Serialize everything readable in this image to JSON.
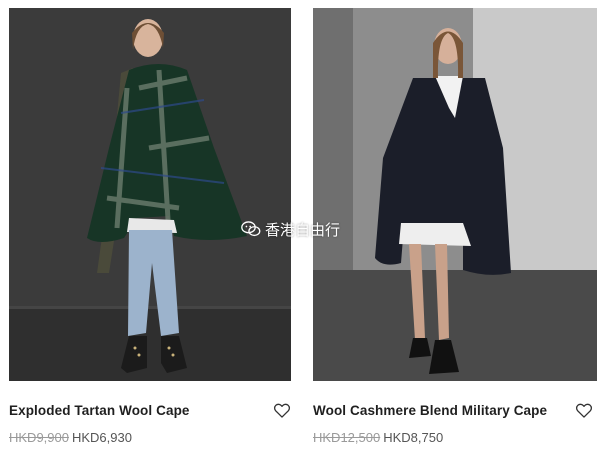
{
  "products": [
    {
      "title": "Exploded Tartan Wool Cape",
      "original_price": "HKD9,900",
      "sale_price": "HKD6,930",
      "favorite_icon": "heart-outline-icon"
    },
    {
      "title": "Wool Cashmere Blend Military Cape",
      "original_price": "HKD12,500",
      "sale_price": "HKD8,750",
      "favorite_icon": "heart-outline-icon"
    }
  ],
  "watermark": {
    "text": "香港自由行",
    "icon": "wechat-icon"
  },
  "colors": {
    "title": "#1f1f1f",
    "old_price": "#9a9a9a",
    "sale_price": "#555555",
    "studio_wall_left": "#3b3b3b",
    "studio_wall_right": "#8d8d8d",
    "tartan_green": "#173526",
    "navy_cape": "#1b1e29"
  }
}
